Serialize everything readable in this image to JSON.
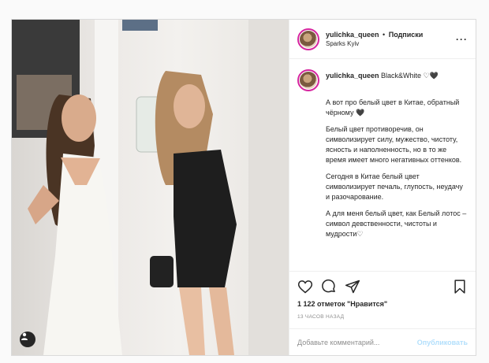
{
  "header": {
    "username": "yulichka_queen",
    "separator": "•",
    "follow_label": "Подписки",
    "location": "Sparks Kyiv",
    "more_label": "···"
  },
  "caption": {
    "username": "yulichka_queen",
    "first_line": "Black&White ♡🖤",
    "paragraphs": [
      "А вот про белый цвет в Китае, обратный чёрному 🖤",
      "Белый цвет противоречив, он символизирует силу, мужество, чистоту, ясность и наполненность, но в то же время имеет много негативных оттенков.",
      "Сегодня в Китае белый цвет символизирует печаль, глупость, неудачу и разочарование.",
      "А для меня белый цвет, как Белый лотос – символ девственности, чистоты и мудрости♡"
    ]
  },
  "actions": {
    "likes": "1 122 отметок \"Нравится\"",
    "time": "13 часов назад"
  },
  "comment": {
    "placeholder": "Добавьте комментарий...",
    "publish_label": "Опубликовать"
  },
  "icons": {
    "like": "heart-icon",
    "comment": "comment-icon",
    "share": "share-icon",
    "save": "bookmark-icon",
    "tag": "user-tag-icon"
  },
  "colors": {
    "story_ring": "#d6249f",
    "publish_disabled": "#b2dffc",
    "muted_text": "#8e8e8e"
  }
}
